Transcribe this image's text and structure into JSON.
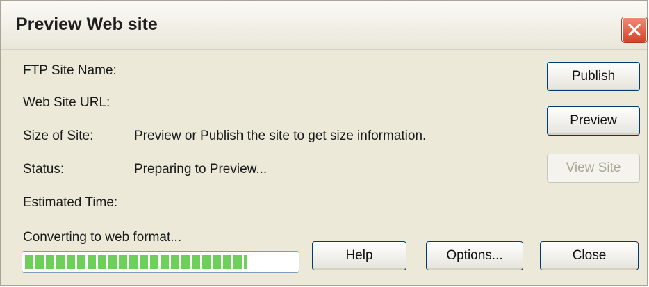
{
  "window": {
    "title": "Preview Web site"
  },
  "fields": {
    "ftp_site_name_label": "FTP Site Name:",
    "web_site_url_label": "Web Site URL:",
    "size_label": "Size of Site:",
    "size_value": "Preview or Publish the site to get size information.",
    "status_label": "Status:",
    "status_value": "Preparing to Preview...",
    "estimated_time_label": "Estimated Time:"
  },
  "progress": {
    "caption": "Converting to web format...",
    "fraction": 0.82,
    "color": "#6fcf5b"
  },
  "buttons": {
    "publish": "Publish",
    "preview": "Preview",
    "view_site": "View Site",
    "help": "Help",
    "options": "Options...",
    "close": "Close"
  },
  "icons": {
    "close": "close-icon"
  }
}
